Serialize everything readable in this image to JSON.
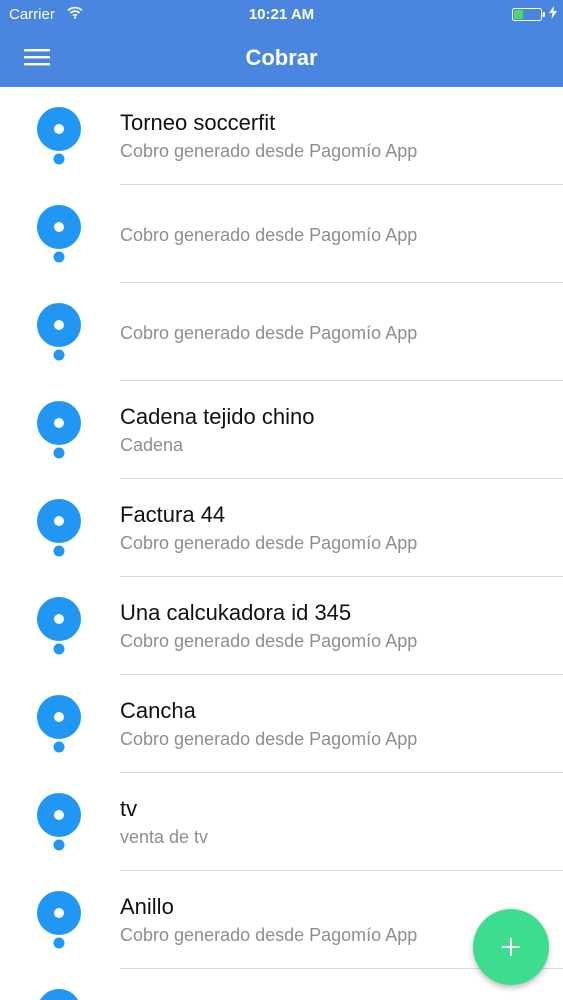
{
  "status_bar": {
    "carrier": "Carrier",
    "time": "10:21 AM",
    "wifi_icon": "wifi-icon",
    "battery_icon": "battery-icon",
    "charging_icon": "charging-bolt-icon",
    "battery_level": 0.3
  },
  "nav_bar": {
    "title": "Cobrar",
    "menu_icon": "hamburger-menu-icon",
    "color": "#4a86e0"
  },
  "items": [
    {
      "title": "Torneo soccerfit",
      "subtitle": "Cobro generado desde Pagomío App"
    },
    {
      "title": "",
      "subtitle": "Cobro generado desde Pagomío App"
    },
    {
      "title": "",
      "subtitle": "Cobro generado desde Pagomío App"
    },
    {
      "title": "Cadena tejido chino",
      "subtitle": "Cadena"
    },
    {
      "title": "Factura 44",
      "subtitle": "Cobro generado desde Pagomío App"
    },
    {
      "title": "Una calcukadora id 345",
      "subtitle": "Cobro generado desde Pagomío App"
    },
    {
      "title": "Cancha",
      "subtitle": "Cobro generado desde Pagomío App"
    },
    {
      "title": "tv",
      "subtitle": "venta de tv"
    },
    {
      "title": "Anillo",
      "subtitle": "Cobro generado desde Pagomío App"
    }
  ],
  "item_icon": "location-pin-icon",
  "item_icon_color": "#2196f3",
  "fab": {
    "icon": "plus-icon",
    "color": "#3ddc8f"
  }
}
